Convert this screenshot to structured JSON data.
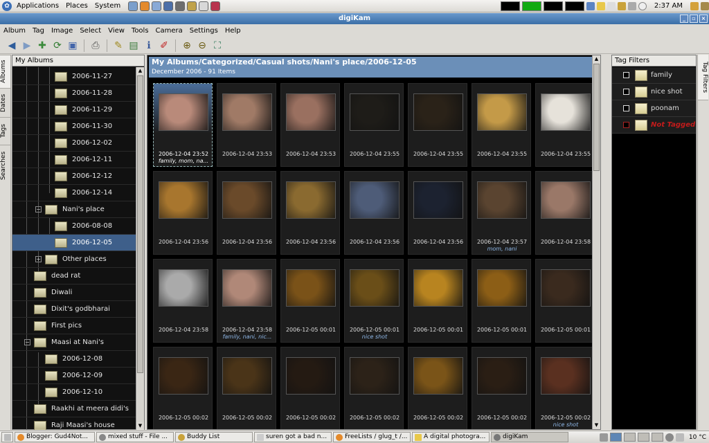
{
  "top_panel": {
    "menus": [
      "Applications",
      "Places",
      "System"
    ],
    "clock": "2:37 AM"
  },
  "window": {
    "title": "digiKam",
    "controls": [
      "_",
      "▫",
      "×"
    ]
  },
  "menubar": [
    "Album",
    "Tag",
    "Image",
    "Select",
    "View",
    "Tools",
    "Camera",
    "Settings",
    "Help"
  ],
  "left_tabs": [
    "Albums",
    "Dates",
    "Tags",
    "Searches"
  ],
  "sidebar": {
    "title": "My Albums",
    "items": [
      {
        "label": "2006-11-27"
      },
      {
        "label": "2006-11-28"
      },
      {
        "label": "2006-11-29"
      },
      {
        "label": "2006-11-30"
      },
      {
        "label": "2006-12-02"
      },
      {
        "label": "2006-12-11"
      },
      {
        "label": "2006-12-12"
      },
      {
        "label": "2006-12-14"
      },
      {
        "label": "Nani's place"
      },
      {
        "label": "2006-08-08"
      },
      {
        "label": "2006-12-05"
      },
      {
        "label": "Other places"
      },
      {
        "label": "dead rat"
      },
      {
        "label": "Diwali"
      },
      {
        "label": "Dixit's godbharai"
      },
      {
        "label": "First pics"
      },
      {
        "label": "Maasi at Nani's"
      },
      {
        "label": "2006-12-08"
      },
      {
        "label": "2006-12-09"
      },
      {
        "label": "2006-12-10"
      },
      {
        "label": "Raakhi at meera didi's"
      },
      {
        "label": "Raji Maasi's house"
      }
    ]
  },
  "main": {
    "path": "My Albums/Categorized/Casual shots/Nani's place/2006-12-05",
    "subtitle": "December 2006 - 91 Items",
    "thumbnails": [
      {
        "date": "2006-12-04 23:52",
        "tags": "family, mom, na...",
        "tone": "#b98a7a"
      },
      {
        "date": "2006-12-04 23:53",
        "tags": "",
        "tone": "#a07a66"
      },
      {
        "date": "2006-12-04 23:53",
        "tags": "",
        "tone": "#9a7060"
      },
      {
        "date": "2006-12-04 23:55",
        "tags": "",
        "tone": "#1e1c18"
      },
      {
        "date": "2006-12-04 23:55",
        "tags": "",
        "tone": "#2a2218"
      },
      {
        "date": "2006-12-04 23:55",
        "tags": "",
        "tone": "#c49a48"
      },
      {
        "date": "2006-12-04 23:55",
        "tags": "",
        "tone": "#e6e2da"
      },
      {
        "date": "2006-12-04 23:56",
        "tags": "",
        "tone": "#a8762e"
      },
      {
        "date": "2006-12-04 23:56",
        "tags": "",
        "tone": "#6a4a2a"
      },
      {
        "date": "2006-12-04 23:56",
        "tags": "",
        "tone": "#8a6a30"
      },
      {
        "date": "2006-12-04 23:56",
        "tags": "",
        "tone": "#4e5c78"
      },
      {
        "date": "2006-12-04 23:56",
        "tags": "",
        "tone": "#1c2230"
      },
      {
        "date": "2006-12-04 23:57",
        "tags": "mom, nani",
        "tone": "#5a4430"
      },
      {
        "date": "2006-12-04 23:58",
        "tags": "",
        "tone": "#9a7868"
      },
      {
        "date": "2006-12-04 23:58",
        "tags": "",
        "tone": "#aaaaaa"
      },
      {
        "date": "2006-12-04 23:58",
        "tags": "family, nani, nic...",
        "tone": "#b08878"
      },
      {
        "date": "2006-12-05 00:01",
        "tags": "",
        "tone": "#7a5218"
      },
      {
        "date": "2006-12-05 00:01",
        "tags": "nice shot",
        "tone": "#6a4e18"
      },
      {
        "date": "2006-12-05 00:01",
        "tags": "",
        "tone": "#b88420"
      },
      {
        "date": "2006-12-05 00:01",
        "tags": "",
        "tone": "#8c5e16"
      },
      {
        "date": "2006-12-05 00:01",
        "tags": "",
        "tone": "#3a2a1e"
      },
      {
        "date": "2006-12-05 00:02",
        "tags": "",
        "tone": "#3a2614"
      },
      {
        "date": "2006-12-05 00:02",
        "tags": "",
        "tone": "#4a3418"
      },
      {
        "date": "2006-12-05 00:02",
        "tags": "",
        "tone": "#241a12"
      },
      {
        "date": "2006-12-05 00:02",
        "tags": "",
        "tone": "#2c2218"
      },
      {
        "date": "2006-12-05 00:02",
        "tags": "",
        "tone": "#7a5418"
      },
      {
        "date": "2006-12-05 00:02",
        "tags": "",
        "tone": "#2a1e14"
      },
      {
        "date": "2006-12-05 00:02",
        "tags": "nice shot",
        "tone": "#5a3020"
      }
    ]
  },
  "tag_filters": {
    "title": "Tag Filters",
    "tags": [
      "family",
      "nice shot",
      "poonam",
      "Not Tagged"
    ]
  },
  "right_tabs": [
    "Tag Filters"
  ],
  "taskbar": {
    "items": [
      "Blogger: Gud4Not...",
      "mixed stuff - File ...",
      "Buddy List",
      "suren got a bad n...",
      "FreeLists / glug_t /...",
      "A digital photogra...",
      "digiKam"
    ],
    "temperature": "10 °C"
  },
  "colors": {
    "title_bar": "#3a6ea7",
    "selection": "#3e5f8a",
    "not_tagged": "#c21b1b",
    "tag_text": "#8fb8e8"
  }
}
